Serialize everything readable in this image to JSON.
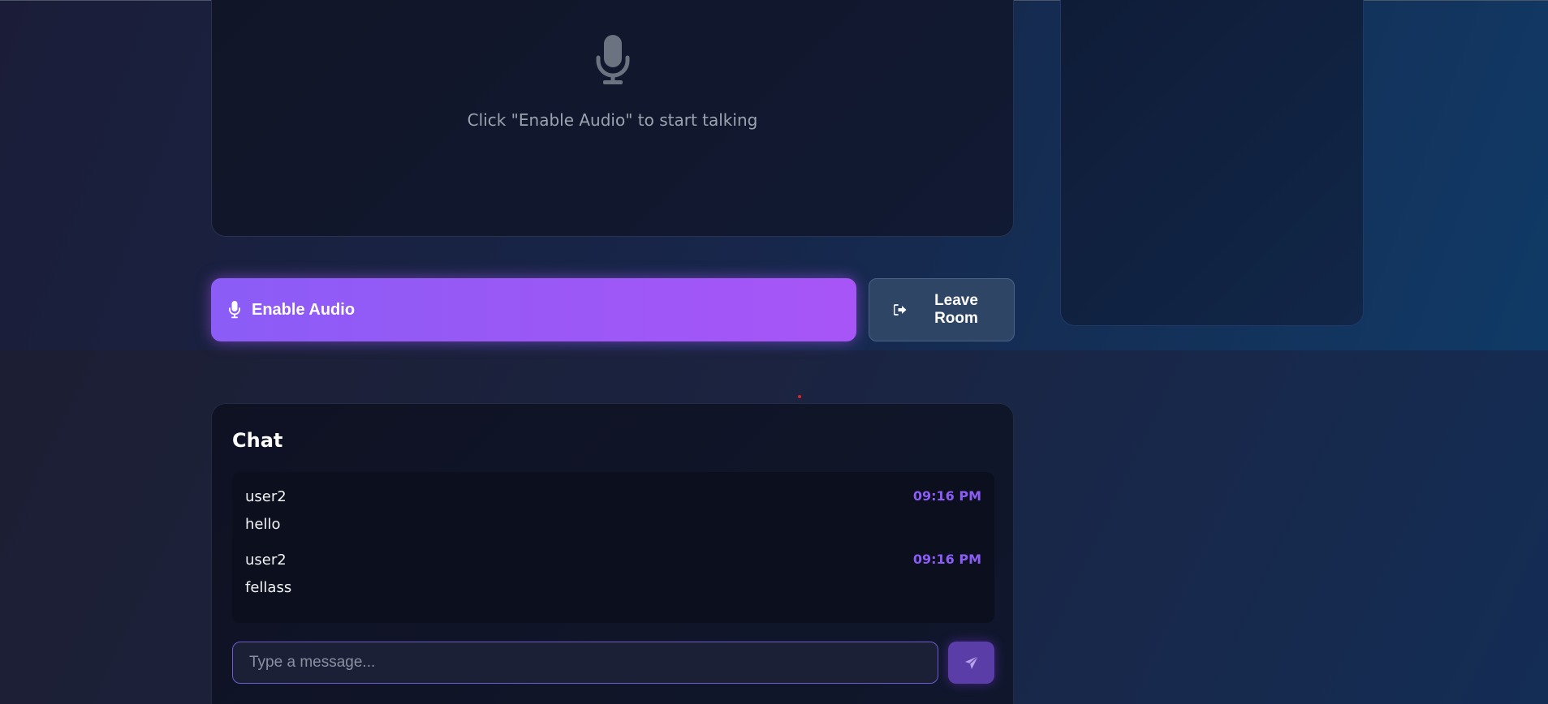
{
  "colors": {
    "accent": "#a855f7",
    "accent_start": "#8b5cf6",
    "timestamp": "#8b5cf6",
    "leave_button_bg": "#2e4566"
  },
  "audio_panel": {
    "icon": "microphone-icon",
    "hint": "Click \"Enable Audio\" to start talking"
  },
  "controls": {
    "enable_audio_icon": "microphone-icon",
    "enable_audio_label": "Enable Audio",
    "leave_room_icon": "sign-out-icon",
    "leave_room_label": "Leave Room"
  },
  "chat": {
    "title": "Chat",
    "messages": [
      {
        "user": "user2",
        "time": "09:16 PM",
        "text": "hello"
      },
      {
        "user": "user2",
        "time": "09:16 PM",
        "text": "fellass"
      }
    ],
    "input_placeholder": "Type a message...",
    "input_value": "",
    "send_icon": "paper-plane-icon"
  }
}
